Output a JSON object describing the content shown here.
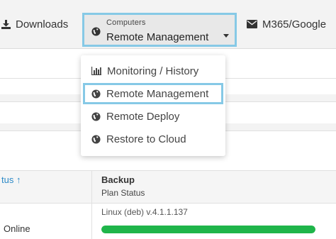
{
  "nav": {
    "downloads_label": "Downloads",
    "computers_label": "Computers",
    "computers_selected": "Remote Management",
    "m365_label": "M365/Google"
  },
  "menu": {
    "items": [
      {
        "label": "Monitoring / History",
        "icon": "bar-chart-icon"
      },
      {
        "label": "Remote Management",
        "icon": "globe-icon",
        "selected": true
      },
      {
        "label": "Remote Deploy",
        "icon": "globe-icon"
      },
      {
        "label": "Restore to Cloud",
        "icon": "globe-icon"
      }
    ]
  },
  "table": {
    "status_header": "tus ↑",
    "backup_header": "Backup",
    "plan_status_header": "Plan Status",
    "row": {
      "status": "Online",
      "version": "Linux (deb) v.4.1.1.137",
      "progress_fraction": 1.0
    }
  },
  "colors": {
    "highlight": "#86c9e6",
    "progress": "#1fb54a",
    "link": "#2d8ac7"
  }
}
